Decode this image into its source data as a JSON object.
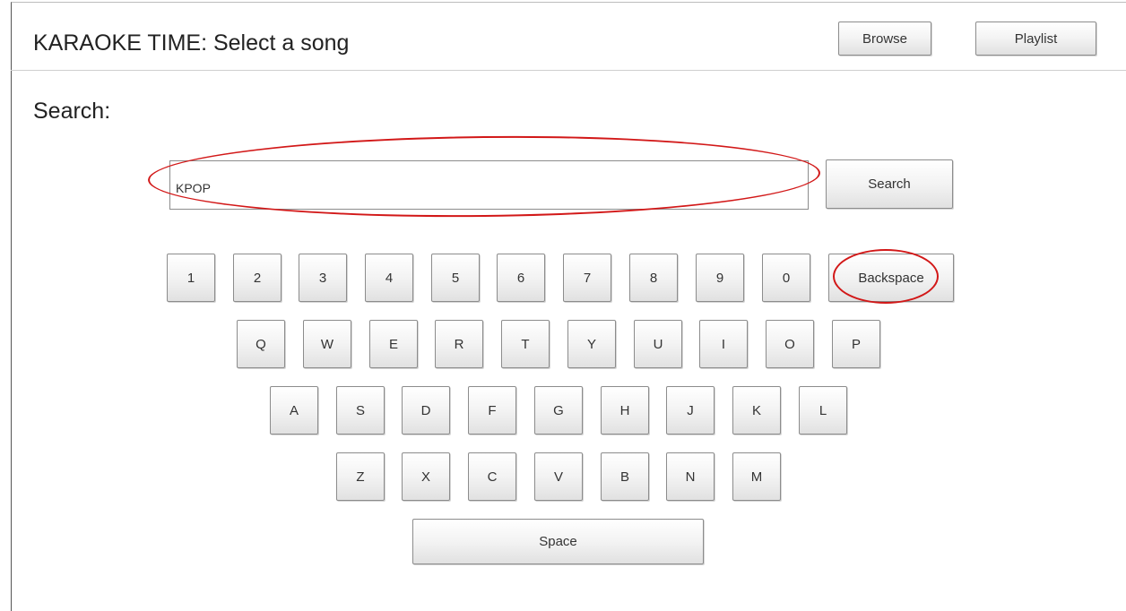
{
  "header": {
    "title": "KARAOKE TIME: Select a song",
    "browse_label": "Browse",
    "playlist_label": "Playlist"
  },
  "search": {
    "label": "Search:",
    "value": "KPOP",
    "button_label": "Search"
  },
  "keyboard": {
    "number_row": [
      "1",
      "2",
      "3",
      "4",
      "5",
      "6",
      "7",
      "8",
      "9",
      "0"
    ],
    "backspace_label": "Backspace",
    "row_qwerty": [
      "Q",
      "W",
      "E",
      "R",
      "T",
      "Y",
      "U",
      "I",
      "O",
      "P"
    ],
    "row_asdf": [
      "A",
      "S",
      "D",
      "F",
      "G",
      "H",
      "J",
      "K",
      "L"
    ],
    "row_zxcv": [
      "Z",
      "X",
      "C",
      "V",
      "B",
      "N",
      "M"
    ],
    "space_label": "Space"
  },
  "annotations": {
    "color": "#d21818",
    "highlighted": [
      "search-input",
      "backspace-key"
    ]
  }
}
